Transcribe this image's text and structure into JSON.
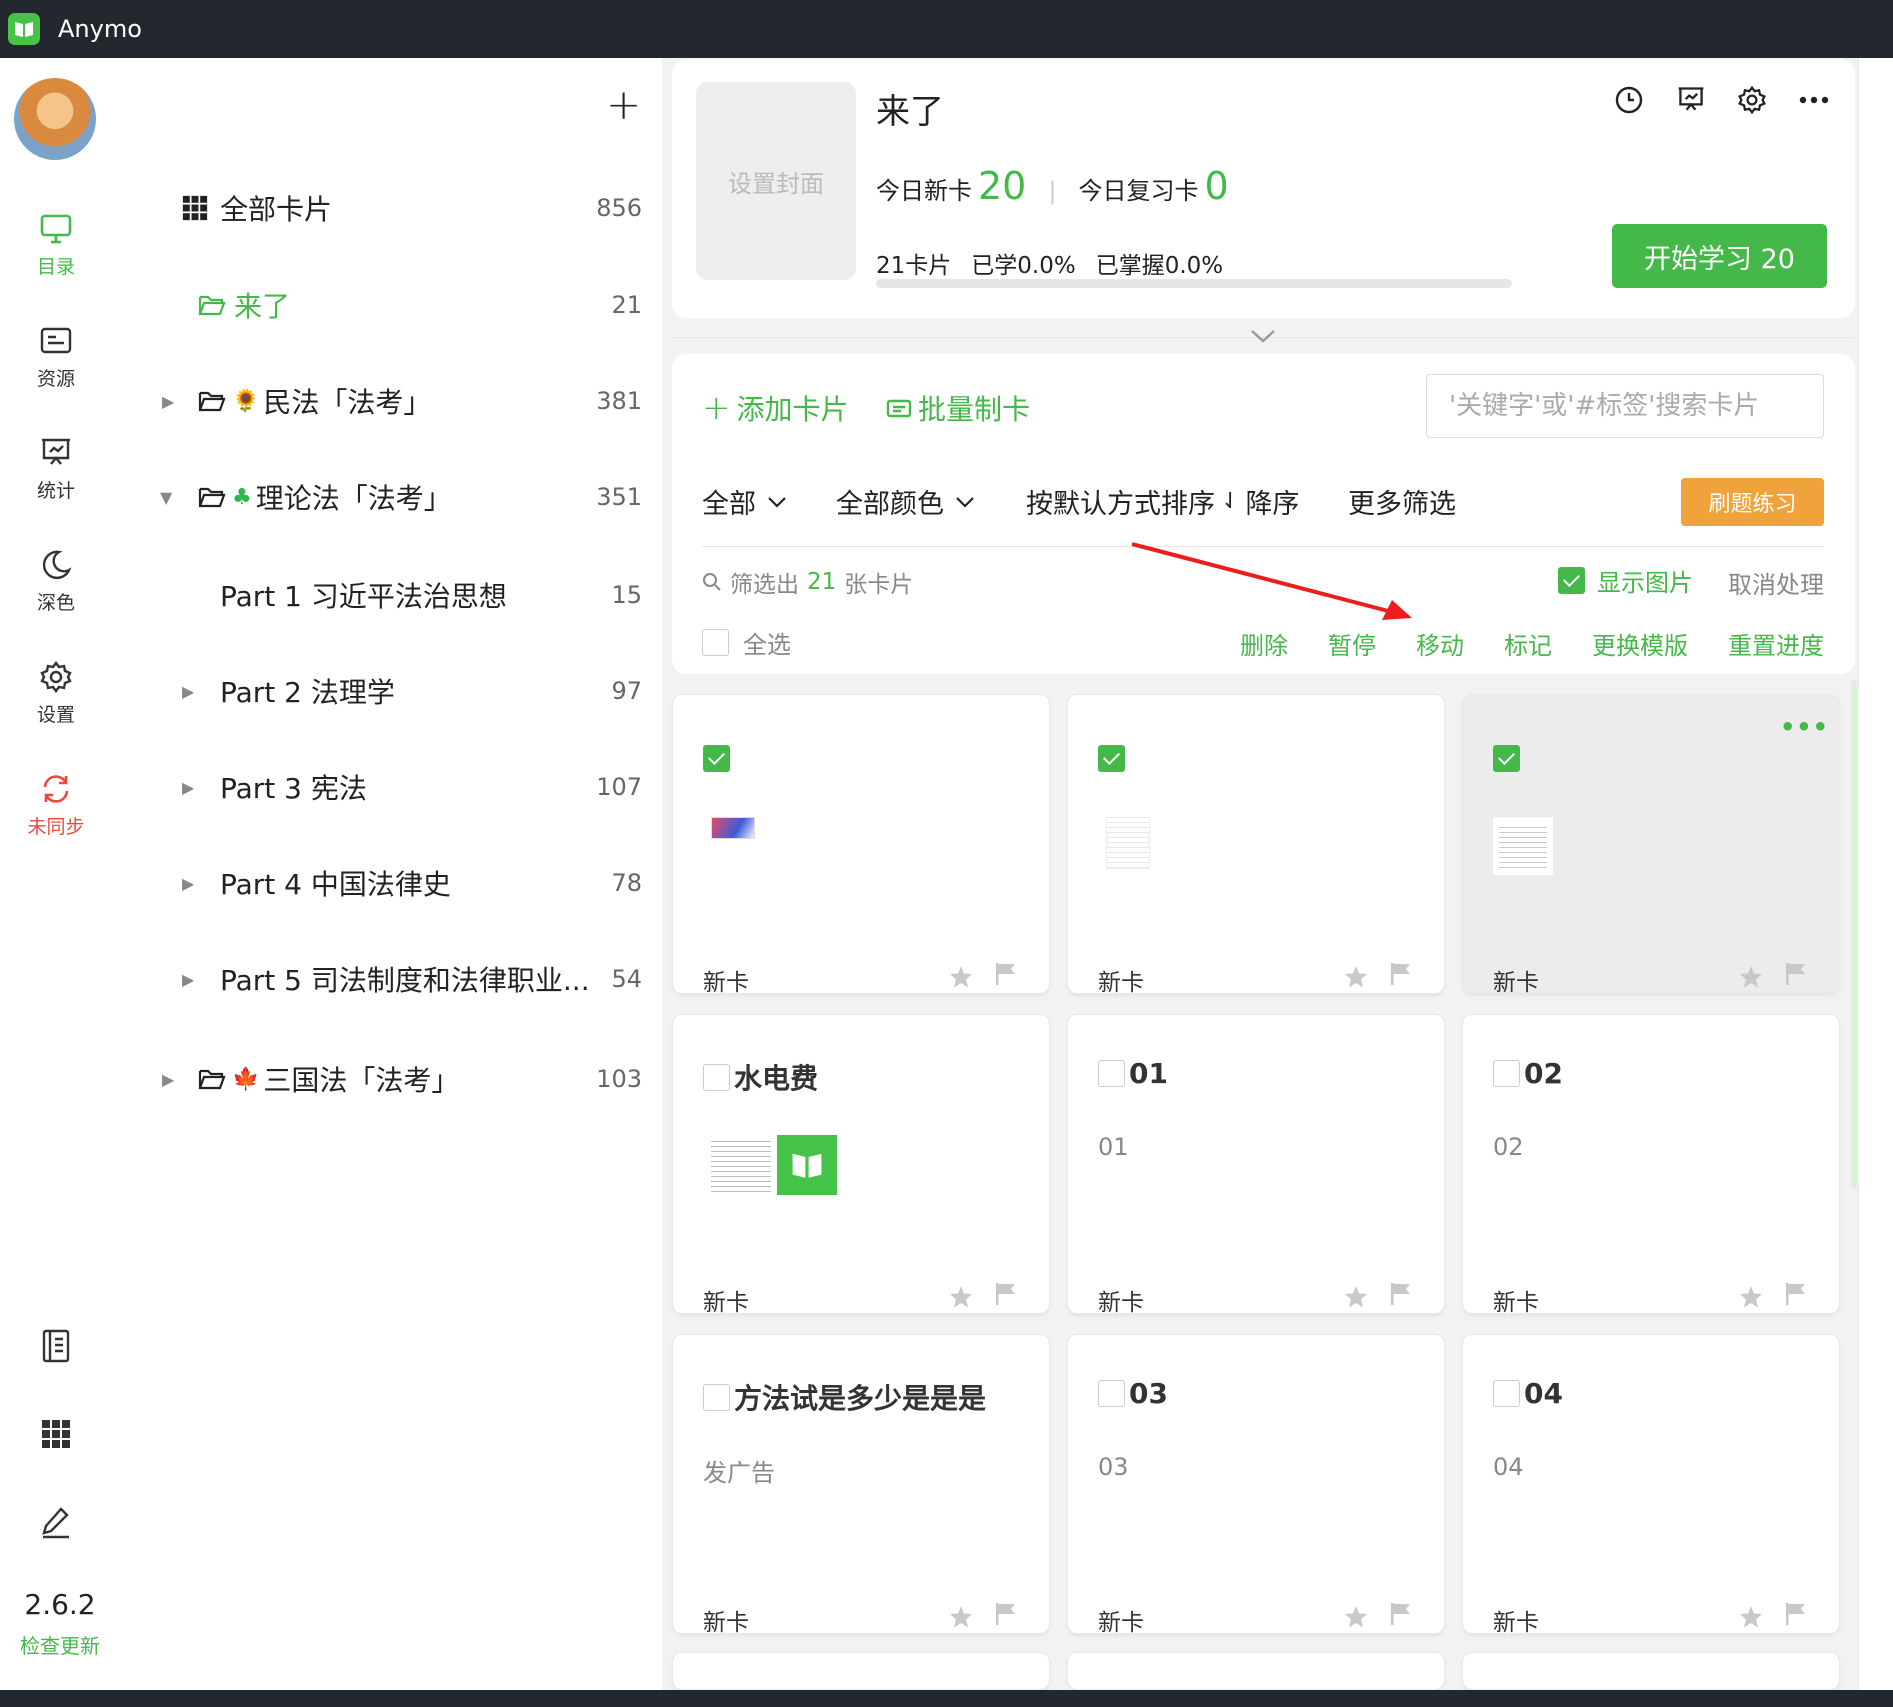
{
  "app": {
    "title": "Anymo",
    "accent": "#45b84a",
    "warn": "#e84a3d",
    "orange": "#f0a33a"
  },
  "rail": {
    "items": [
      {
        "label": "目录",
        "icon": "monitor-icon",
        "state": "active"
      },
      {
        "label": "资源",
        "icon": "resource-icon",
        "state": "normal"
      },
      {
        "label": "统计",
        "icon": "stats-icon",
        "state": "normal"
      },
      {
        "label": "深色",
        "icon": "moon-icon",
        "state": "normal"
      },
      {
        "label": "设置",
        "icon": "gear-icon",
        "state": "normal"
      },
      {
        "label": "未同步",
        "icon": "sync-icon",
        "state": "warn"
      }
    ],
    "bottom_icons": [
      "notebook-icon",
      "grid-icon",
      "pen-icon"
    ],
    "version": "2.6.2",
    "check_update": "检查更新"
  },
  "tree": {
    "rows": [
      {
        "label": "全部卡片",
        "count": "856",
        "icon": "grid-icon"
      },
      {
        "label": "来了",
        "count": "21",
        "icon": "folder-icon",
        "active": true
      },
      {
        "label": "民法「法考」",
        "count": "381",
        "icon": "folder-icon",
        "emoji": "🌻",
        "expand": "collapsed"
      },
      {
        "label": "理论法「法考」",
        "count": "351",
        "icon": "folder-icon",
        "emoji": "🍀",
        "expand": "expanded"
      },
      {
        "label": "Part 1 习近平法治思想",
        "count": "15"
      },
      {
        "label": "Part 2 法理学",
        "count": "97",
        "expand": "collapsed"
      },
      {
        "label": "Part 3 宪法",
        "count": "107",
        "expand": "collapsed"
      },
      {
        "label": "Part 4 中国法律史",
        "count": "78",
        "expand": "collapsed"
      },
      {
        "label": "Part 5 司法制度和法律职业...",
        "count": "54",
        "expand": "collapsed"
      },
      {
        "label": "三国法「法考」",
        "count": "103",
        "icon": "folder-icon",
        "emoji": "🍁",
        "expand": "collapsed"
      }
    ]
  },
  "deck": {
    "cover_label": "设置封面",
    "title": "来了",
    "today_new_label": "今日新卡",
    "today_new": "20",
    "today_review_label": "今日复习卡",
    "today_review": "0",
    "cards_count": "21卡片",
    "learned": "已学0.0%",
    "mastered": "已掌握0.0%",
    "progress": 0.0,
    "start_button": "开始学习 20",
    "icons": [
      "clock-icon",
      "present-icon",
      "gear-icon",
      "more-icon"
    ]
  },
  "toolbar": {
    "add_card": "添加卡片",
    "batch_make": "批量制卡",
    "search_placeholder": "'关键字'或'#标签'搜索卡片",
    "filter_all": "全部",
    "filter_color": "全部颜色",
    "sort": "按默认方式排序",
    "sort_order": "降序",
    "more_filter": "更多筛选",
    "drill": "刷题练习",
    "filtered_prefix": "筛选出",
    "filtered_count": "21",
    "filtered_suffix": "张卡片",
    "show_images": "显示图片",
    "cancel_processing": "取消处理",
    "select_all": "全选",
    "ops": [
      "删除",
      "暂停",
      "移动",
      "标记",
      "更换模版",
      "重置进度"
    ]
  },
  "cards": [
    {
      "title": "",
      "body": "",
      "status": "新卡",
      "checked": true,
      "thumb": "gradient"
    },
    {
      "title": "",
      "body": "",
      "status": "新卡",
      "checked": true,
      "thumb": "doc"
    },
    {
      "title": "",
      "body": "",
      "status": "新卡",
      "checked": true,
      "thumb": "doc-white",
      "hover": true
    },
    {
      "title": "水电费",
      "body": "",
      "status": "新卡",
      "checked": false,
      "thumb": "doc-logo"
    },
    {
      "title": "01",
      "body": "01",
      "status": "新卡",
      "checked": false
    },
    {
      "title": "02",
      "body": "02",
      "status": "新卡",
      "checked": false
    },
    {
      "title": "方法试是多少是是是",
      "body": "发广告",
      "status": "新卡",
      "checked": false
    },
    {
      "title": "03",
      "body": "03",
      "status": "新卡",
      "checked": false
    },
    {
      "title": "04",
      "body": "04",
      "status": "新卡",
      "checked": false
    }
  ]
}
